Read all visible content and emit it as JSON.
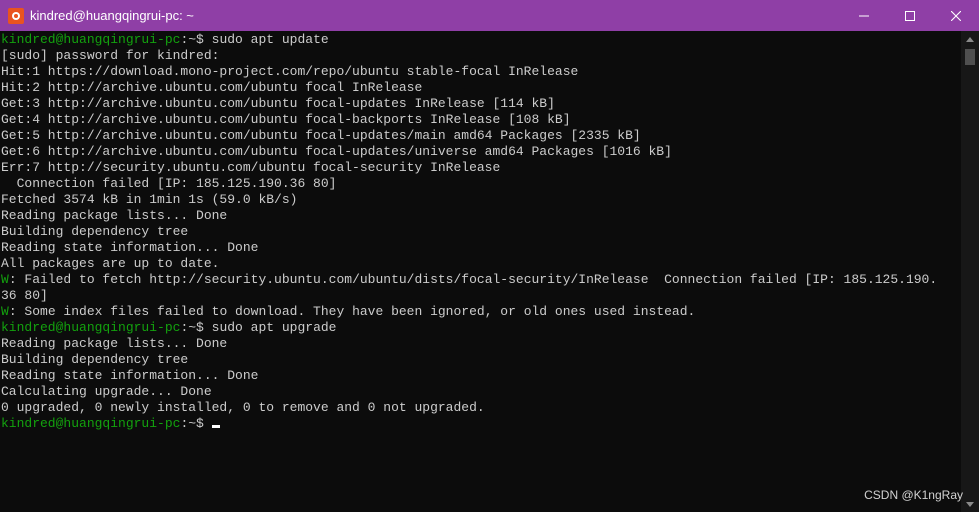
{
  "window": {
    "title": "kindred@huangqingrui-pc: ~",
    "icon": "ubuntu-app-icon",
    "title_bg": "#8f3fa6",
    "controls": {
      "minimize_icon": "minimize-icon",
      "maximize_icon": "maximize-icon",
      "close_icon": "close-icon"
    }
  },
  "colors": {
    "background": "#0c0c0c",
    "text": "#cccccc",
    "prompt": "#13a10e",
    "icon_orange": "#e95420"
  },
  "terminal": {
    "l1": {
      "prompt": "kindred@huangqingrui-pc",
      "sep": ":~$ ",
      "cmd": "sudo apt update"
    },
    "l2": "[sudo] password for kindred:",
    "l3": "Hit:1 https://download.mono-project.com/repo/ubuntu stable-focal InRelease",
    "l4": "Hit:2 http://archive.ubuntu.com/ubuntu focal InRelease",
    "l5": "Get:3 http://archive.ubuntu.com/ubuntu focal-updates InRelease [114 kB]",
    "l6": "Get:4 http://archive.ubuntu.com/ubuntu focal-backports InRelease [108 kB]",
    "l7": "Get:5 http://archive.ubuntu.com/ubuntu focal-updates/main amd64 Packages [2335 kB]",
    "l8": "Get:6 http://archive.ubuntu.com/ubuntu focal-updates/universe amd64 Packages [1016 kB]",
    "l9": "Err:7 http://security.ubuntu.com/ubuntu focal-security InRelease",
    "l10": "  Connection failed [IP: 185.125.190.36 80]",
    "l11": "Fetched 3574 kB in 1min 1s (59.0 kB/s)",
    "l12": "Reading package lists... Done",
    "l13": "Building dependency tree",
    "l14": "Reading state information... Done",
    "l15": "All packages are up to date.",
    "l16": {
      "tag": "W",
      "text": ": Failed to fetch http://security.ubuntu.com/ubuntu/dists/focal-security/InRelease  Connection failed [IP: 185.125.190."
    },
    "l17": "36 80]",
    "l18": {
      "tag": "W",
      "text": ": Some index files failed to download. They have been ignored, or old ones used instead."
    },
    "l19": {
      "prompt": "kindred@huangqingrui-pc",
      "sep": ":~$ ",
      "cmd": "sudo apt upgrade"
    },
    "l20": "Reading package lists... Done",
    "l21": "Building dependency tree",
    "l22": "Reading state information... Done",
    "l23": "Calculating upgrade... Done",
    "l24": "0 upgraded, 0 newly installed, 0 to remove and 0 not upgraded.",
    "l25": {
      "prompt": "kindred@huangqingrui-pc",
      "sep": ":~$ ",
      "cmd": ""
    }
  },
  "watermark": "CSDN @K1ngRay"
}
